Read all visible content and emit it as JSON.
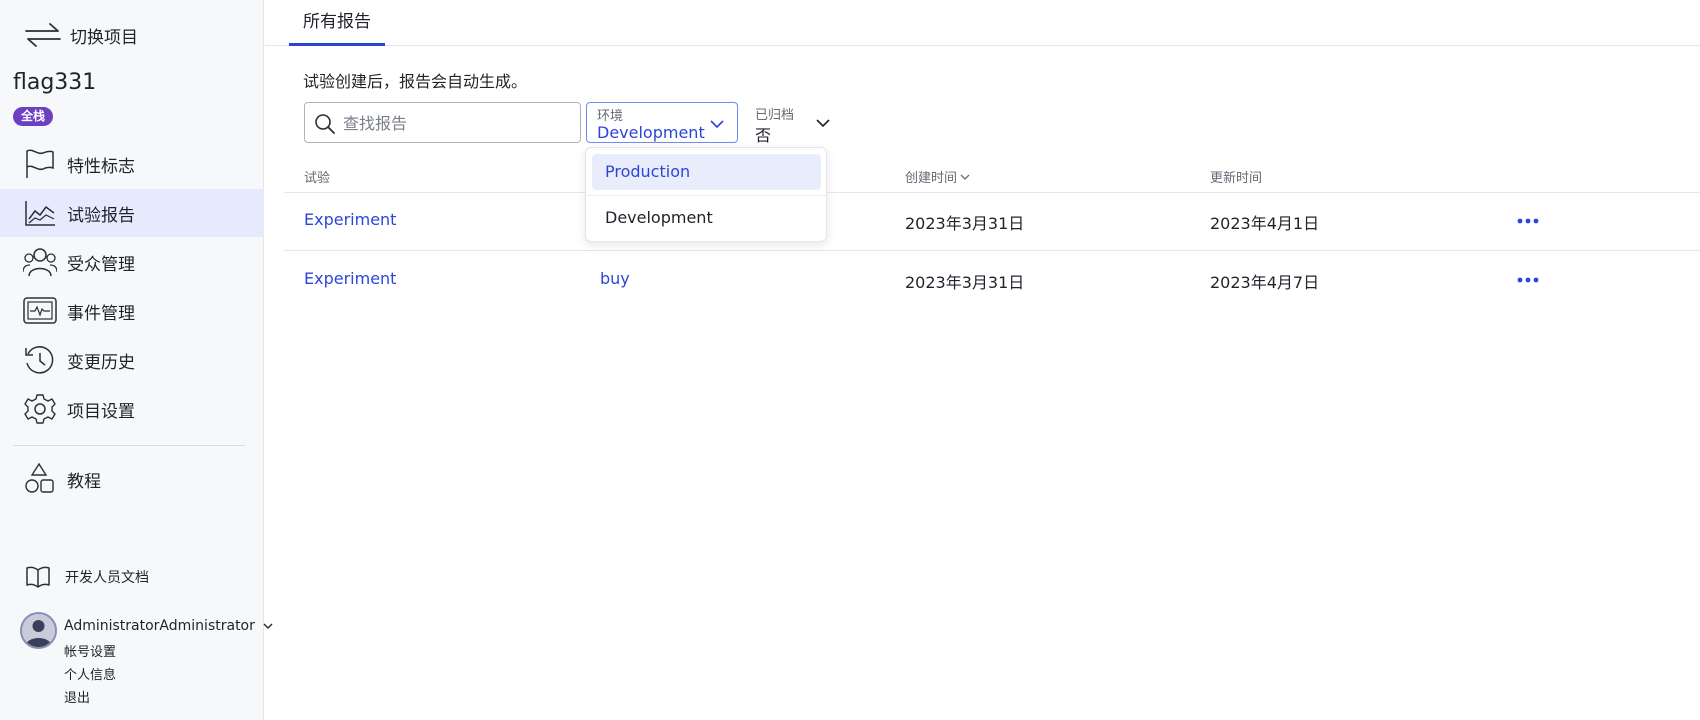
{
  "sidebar": {
    "switch_label": "切换项目",
    "project_name": "flag331",
    "badge": "全栈",
    "nav": [
      {
        "label": "特性标志",
        "icon": "flag-icon"
      },
      {
        "label": "试验报告",
        "icon": "chart-icon",
        "active": true
      },
      {
        "label": "受众管理",
        "icon": "users-icon"
      },
      {
        "label": "事件管理",
        "icon": "event-icon"
      },
      {
        "label": "变更历史",
        "icon": "history-icon"
      },
      {
        "label": "项目设置",
        "icon": "gear-icon"
      },
      {
        "label": "教程",
        "icon": "shapes-icon"
      }
    ],
    "docs_label": "开发人员文档",
    "user": {
      "name": "AdministratorAdministrator",
      "links": [
        "帐号设置",
        "个人信息",
        "退出"
      ]
    }
  },
  "main": {
    "tab": "所有报告",
    "hint": "试验创建后，报告会自动生成。",
    "search_placeholder": "查找报告",
    "env_filter": {
      "caption": "环境",
      "value": "Development"
    },
    "archive_filter": {
      "caption": "已归档",
      "value": "否"
    },
    "dropdown": {
      "options": [
        "Production",
        "Development"
      ],
      "highlighted": "Production"
    },
    "columns": [
      "试验",
      "创建时间",
      "更新时间"
    ],
    "rows": [
      {
        "experiment": "Experiment",
        "event": "",
        "created": "2023年3月31日",
        "updated": "2023年4月1日"
      },
      {
        "experiment": "Experiment",
        "event": "buy",
        "created": "2023年3月31日",
        "updated": "2023年4月7日"
      }
    ]
  },
  "colors": {
    "accent": "#2c45d8",
    "badge": "#6d3fc2",
    "active_nav_bg": "#e6eafc"
  }
}
